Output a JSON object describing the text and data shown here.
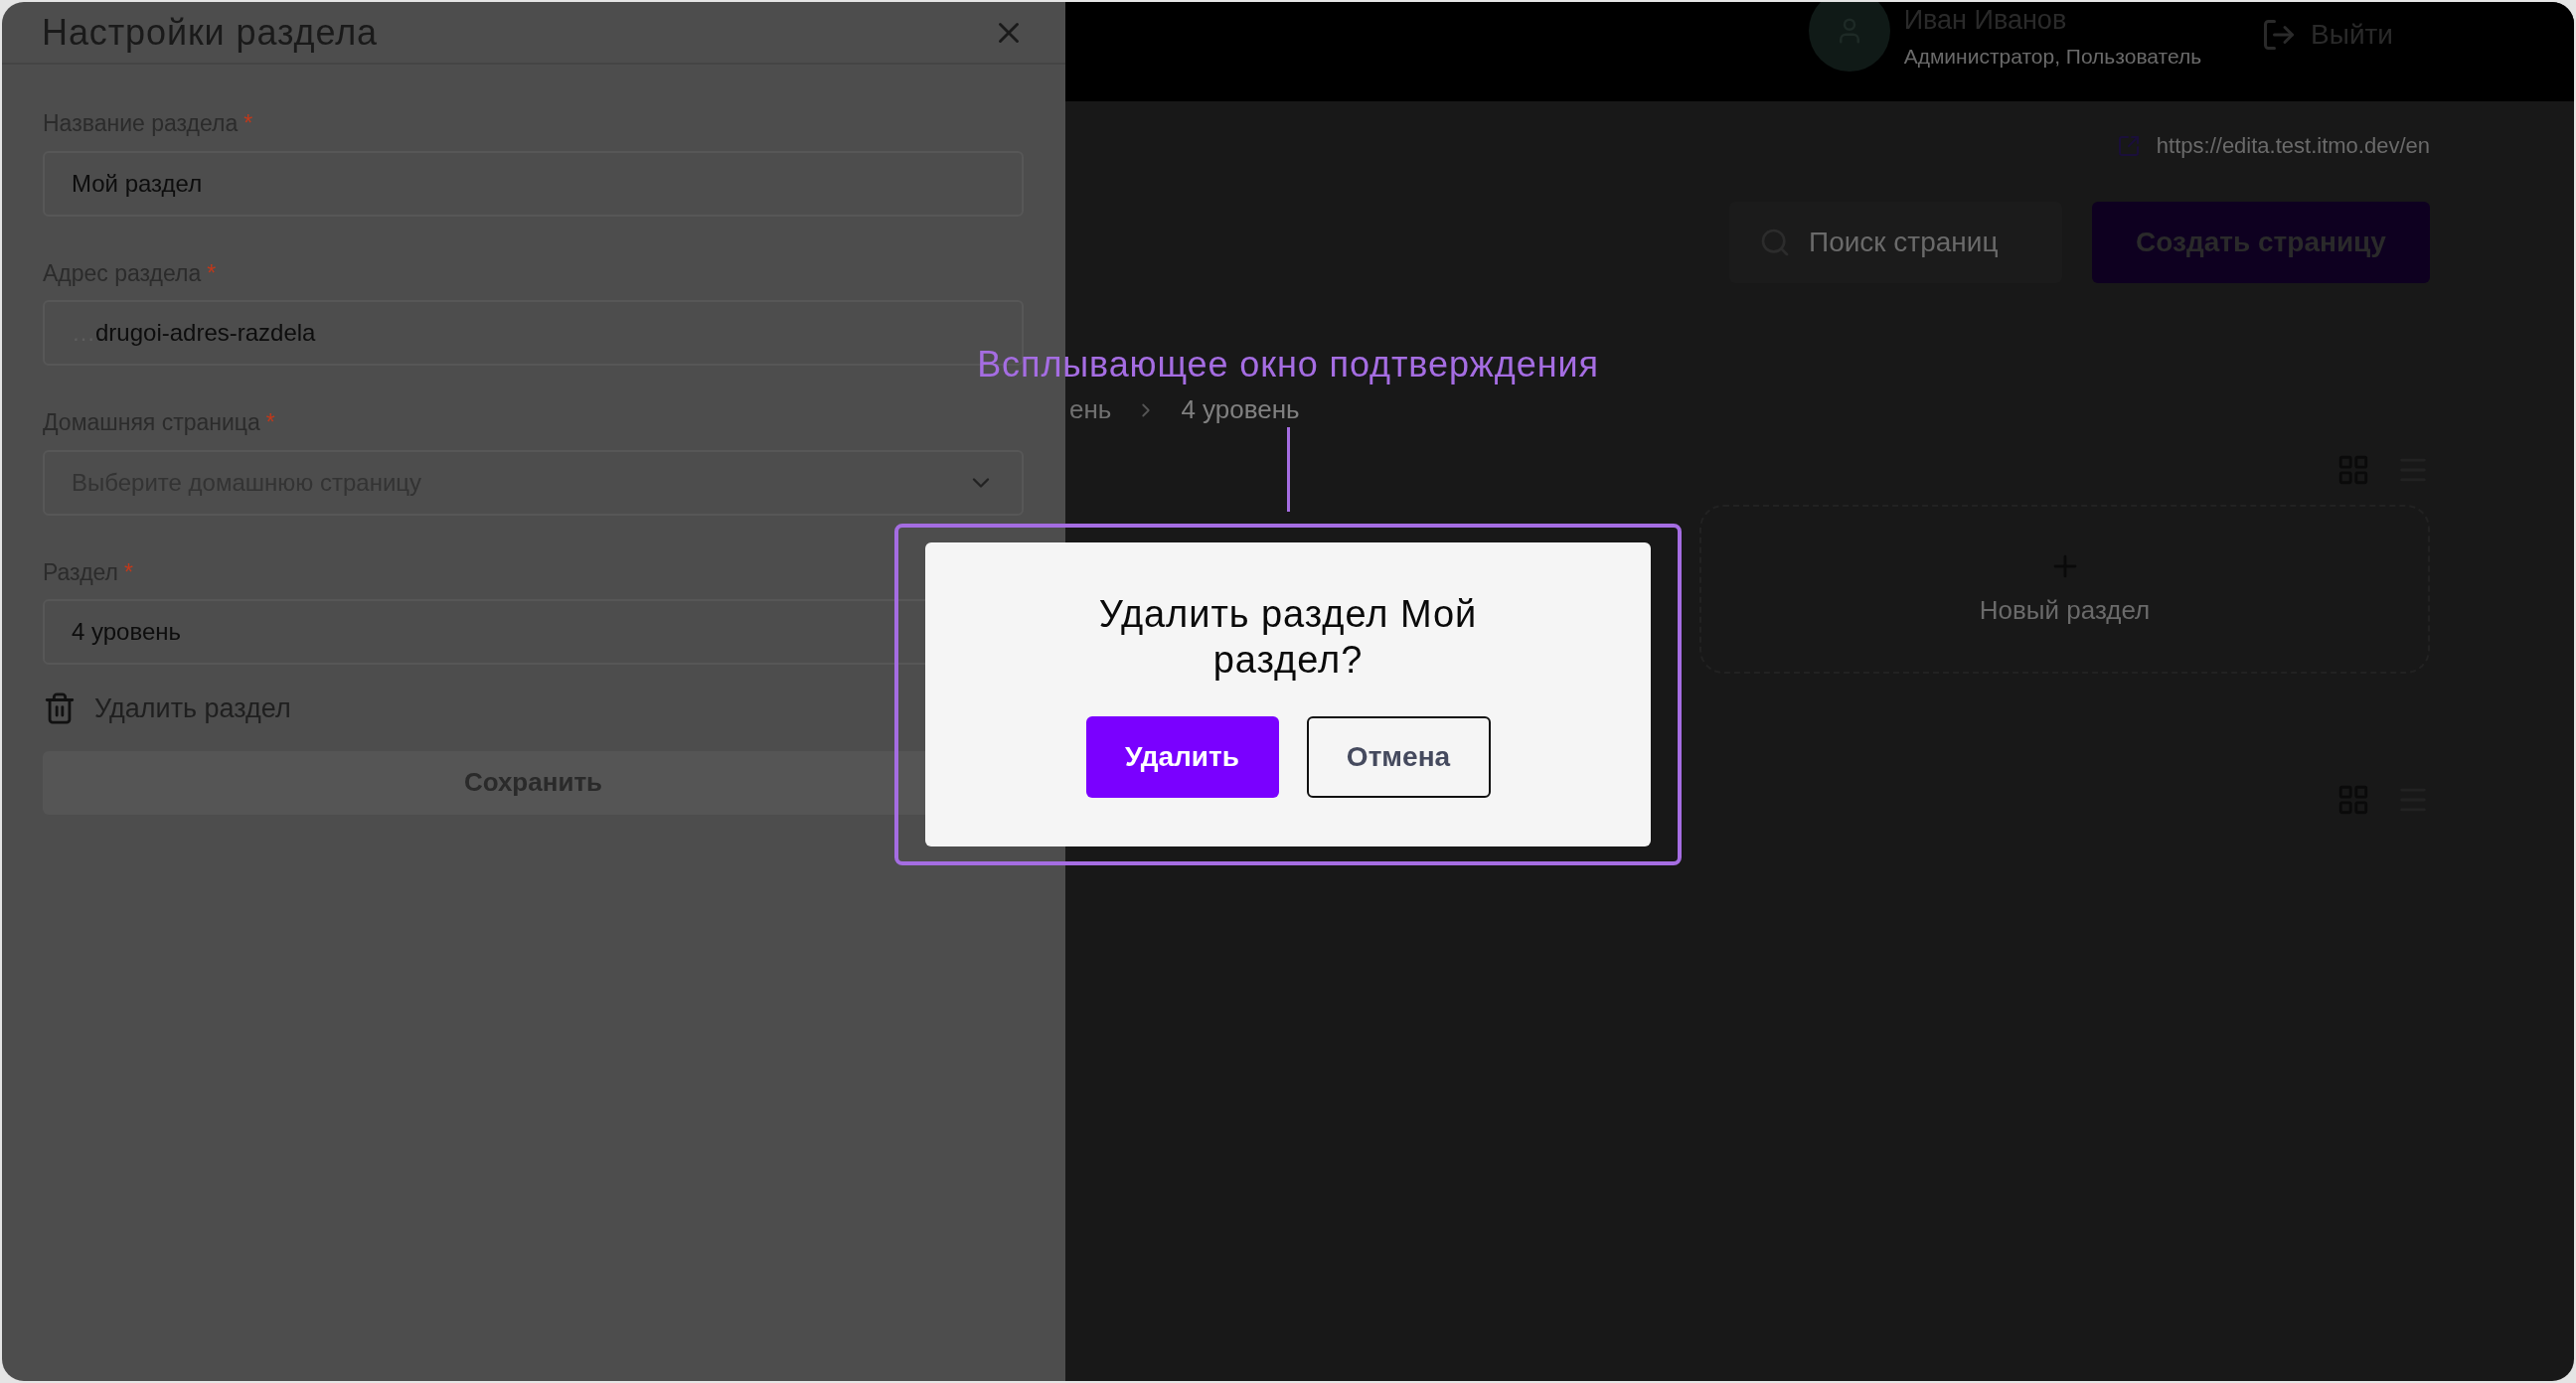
{
  "settings_panel": {
    "title": "Настройки раздела",
    "fields": [
      {
        "kind": "text",
        "label": "Название раздела",
        "marker": "*",
        "value": "Мой раздел"
      },
      {
        "kind": "address",
        "label": "Адрес раздела",
        "marker": "*",
        "prefix": "…",
        "value": "drugoi-adres-razdela"
      },
      {
        "kind": "select",
        "label": "Домашняя страница",
        "marker": "*",
        "placeholder": "Выберите домашнюю страницу"
      },
      {
        "kind": "text",
        "label": "Раздел",
        "marker": "*",
        "value": "4 уровень"
      }
    ],
    "delete_link": "Удалить раздел",
    "save_button": "Сохранить"
  },
  "header": {
    "user_name": "Иван Иванов",
    "user_role": "Администратор, Пользователь",
    "logout": "Выйти"
  },
  "site_link": "https://edita.test.itmo.dev/en",
  "search": {
    "placeholder": "Поиск страниц"
  },
  "create_button": "Создать страницу",
  "breadcrumb": [
    "ень",
    "4 уровень"
  ],
  "new_section_card": {
    "label": "Новый раздел"
  },
  "confirm_dialog": {
    "title": "Удалить раздел Мой раздел?",
    "buttons": [
      {
        "kind": "primary",
        "label": "Удалить"
      },
      {
        "kind": "secondary",
        "label": "Отмена"
      }
    ]
  },
  "annotation": {
    "label": "Всплывающее окно подтверждения"
  }
}
